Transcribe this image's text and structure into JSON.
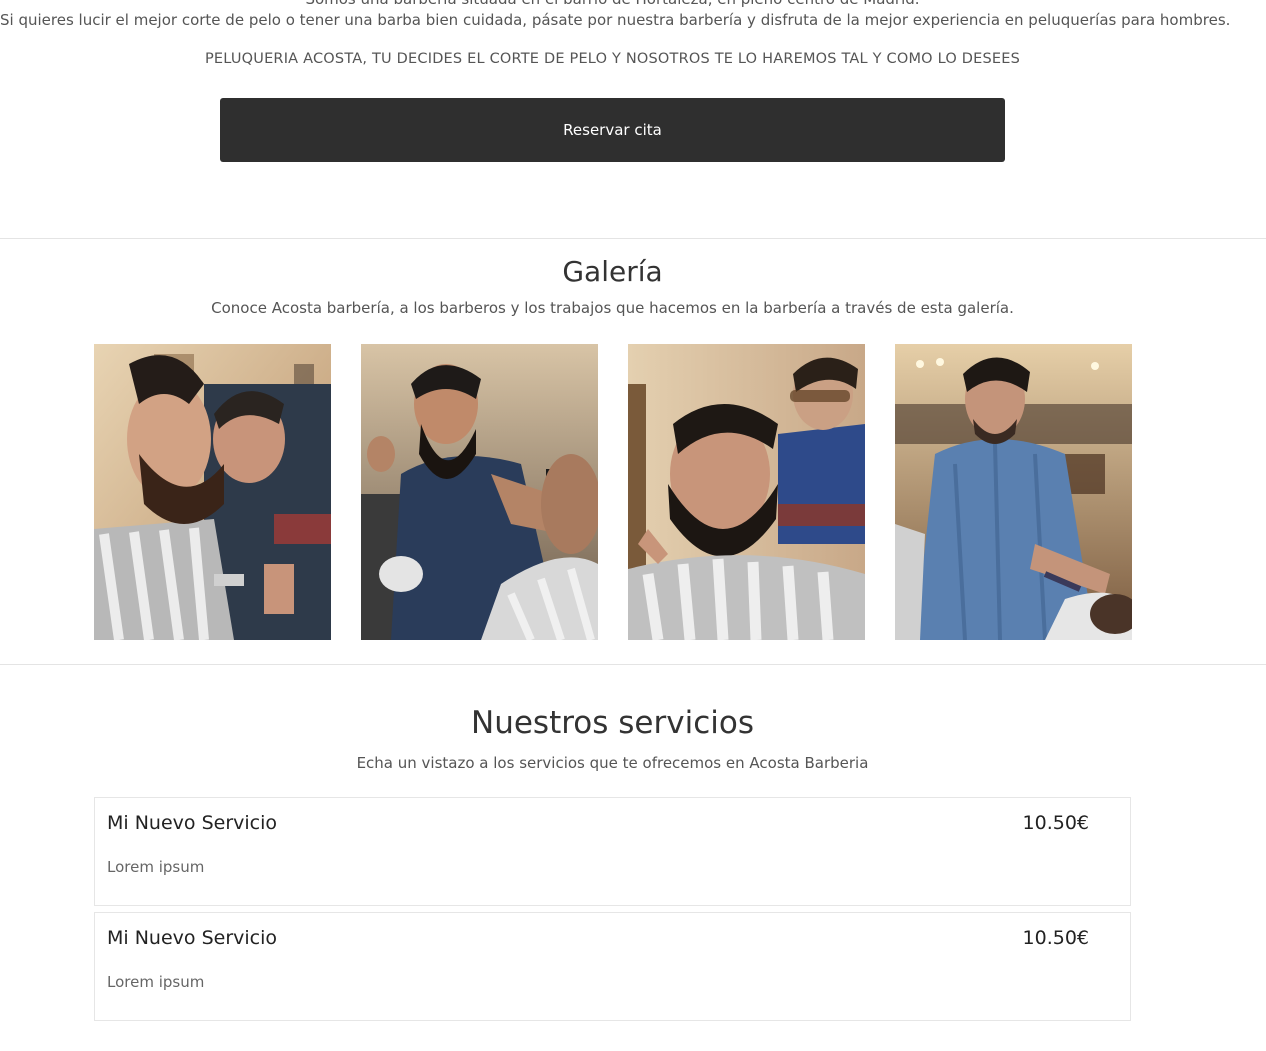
{
  "intro": {
    "clipped_line": "Somos una barbería situada en el barrio de Hortaleza, en pleno centro de Madrid.",
    "paragraph": "Si quieres lucir el mejor corte de pelo o tener una barba bien cuidada, pásate por nuestra barbería y disfruta de la mejor experiencia en peluquerías para hombres.",
    "tagline": "PELUQUERIA ACOSTA, TU DECIDES EL CORTE DE PELO Y NOSOTROS TE LO HAREMOS TAL Y COMO LO DESEES",
    "cta_label": "Reservar cita"
  },
  "gallery": {
    "title": "Galería",
    "subtitle": "Conoce Acosta barbería, a los barberos y los trabajos que hacemos en la barbería a través de esta galería.",
    "photos": [
      "barber-trimming-beard-photo",
      "barber-shaping-beard-photo",
      "smiling-bearded-client-photo",
      "barber-working-in-shop-photo"
    ]
  },
  "services": {
    "title": "Nuestros servicios",
    "subtitle": "Echa un vistazo a los servicios que te ofrecemos en Acosta Barberia",
    "items": [
      {
        "name": "Mi Nuevo Servicio",
        "price": "10.50€",
        "description": "Lorem ipsum"
      },
      {
        "name": "Mi Nuevo Servicio",
        "price": "10.50€",
        "description": "Lorem ipsum"
      }
    ]
  }
}
